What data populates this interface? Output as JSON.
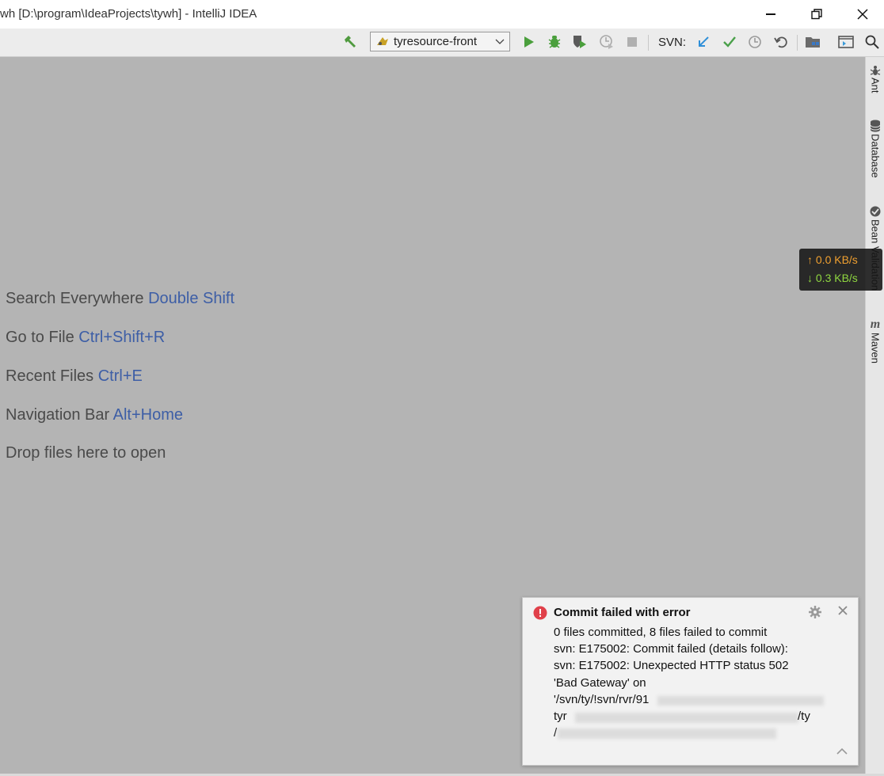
{
  "window": {
    "title": "wh [D:\\program\\IdeaProjects\\tywh] - IntelliJ IDEA"
  },
  "toolbar": {
    "run_config": "tyresource-front",
    "svn_label": "SVN:",
    "icons": [
      "build-hammer-icon",
      "run-icon",
      "debug-icon",
      "coverage-icon",
      "profile-icon",
      "stop-icon",
      "svn-update-icon",
      "svn-commit-icon",
      "svn-history-icon",
      "svn-revert-icon",
      "project-structure-icon",
      "terminal-icon",
      "search-icon"
    ]
  },
  "hints": [
    {
      "label": "Search Everywhere",
      "shortcut": "Double Shift"
    },
    {
      "label": "Go to File",
      "shortcut": "Ctrl+Shift+R"
    },
    {
      "label": "Recent Files",
      "shortcut": "Ctrl+E"
    },
    {
      "label": "Navigation Bar",
      "shortcut": "Alt+Home"
    },
    {
      "label": "Drop files here to open",
      "shortcut": ""
    }
  ],
  "sidebar": {
    "items": [
      {
        "label": "Ant"
      },
      {
        "label": "Database"
      },
      {
        "label": "Bean Validation"
      },
      {
        "label": "Maven"
      }
    ]
  },
  "netspeed": {
    "upload": "0.0 KB/s",
    "download": "0.3 KB/s"
  },
  "notification": {
    "title": "Commit failed with error",
    "lines": [
      "0 files committed, 8 files failed to commit",
      "svn: E175002: Commit failed (details follow):",
      "svn: E175002: Unexpected HTTP status 502",
      "'Bad Gateway' on",
      "'/svn/ty/!svn/rvr/91",
      "tyr",
      "/"
    ],
    "line6_tail": "/ty"
  },
  "colors": {
    "editor_bg": "#b4b4b4",
    "shortcut": "#3d5ea6",
    "error": "#e0404a",
    "upload": "#f0a030",
    "download": "#8fd640"
  }
}
